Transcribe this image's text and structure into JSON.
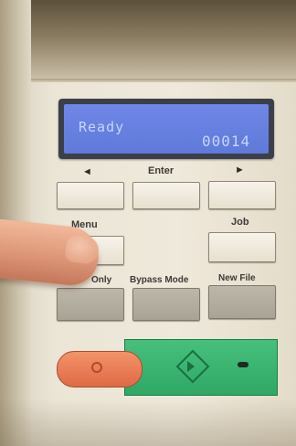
{
  "display": {
    "status_text": "Ready",
    "counter_text": "00014"
  },
  "nav_row": {
    "left_arrow": "◄",
    "enter_label": "Enter",
    "right_arrow": "►"
  },
  "second_row": {
    "menu_label": "Menu",
    "job_label": "Job"
  },
  "mode_row": {
    "copy_only_label": "Only",
    "bypass_label": "Bypass Mode",
    "new_file_label": "New File"
  },
  "colors": {
    "lcd": "#5f7ad9",
    "stop_button": "#e06a43",
    "start_button": "#2fa865"
  },
  "icons": [
    "finger",
    "stop-icon",
    "start-diamond-icon",
    "status-led"
  ]
}
